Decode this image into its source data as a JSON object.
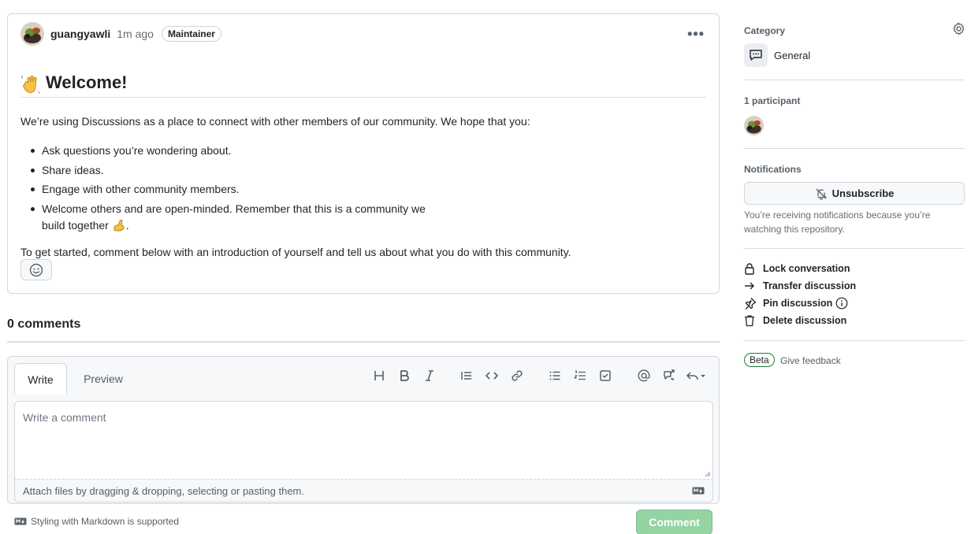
{
  "post": {
    "author": "guangyawli",
    "time": "1m ago",
    "badge": "Maintainer",
    "more_label": "•••",
    "title": "Welcome!",
    "intro": "We’re using Discussions as a place to connect with other members of our community. We hope that you:",
    "bullets": [
      "Ask questions you’re wondering about.",
      "Share ideas.",
      "Engage with other community members."
    ],
    "bullet_last_line1": "Welcome others and are open-minded. Remember that this is a community we",
    "bullet_last_line2": "build together",
    "bullet_last_suffix": ".",
    "outro": "To get started, comment below with an introduction of yourself and tell us about what you do with this community."
  },
  "comments": {
    "count_label": "0 comments"
  },
  "editor": {
    "tab_write": "Write",
    "tab_preview": "Preview",
    "placeholder": "Write a comment",
    "attach_text": "Attach files by dragging & dropping, selecting or pasting them.",
    "markdown_note": "Styling with Markdown is supported",
    "submit_label": "Comment",
    "toolbar_icons": [
      "heading-icon",
      "bold-icon",
      "italic-icon",
      "quote-icon",
      "code-icon",
      "link-icon",
      "unordered-list-icon",
      "ordered-list-icon",
      "tasklist-icon",
      "mention-icon",
      "cross-reference-icon",
      "reply-icon"
    ]
  },
  "sidebar": {
    "category_label": "Category",
    "category_name": "General",
    "participants_label": "1 participant",
    "notifications_label": "Notifications",
    "unsubscribe_label": "Unsubscribe",
    "notifications_text": "You’re receiving notifications because you’re watching this repository.",
    "actions": {
      "lock": "Lock conversation",
      "transfer": "Transfer discussion",
      "pin": "Pin discussion",
      "delete": "Delete discussion"
    },
    "beta_label": "Beta",
    "feedback_label": "Give feedback"
  },
  "colors": {
    "post_border": "#c9d9ec",
    "comment_button": "#94d3a2",
    "beta_border": "#1a7f37",
    "text_primary": "#1f2328",
    "text_muted": "#656d76"
  }
}
